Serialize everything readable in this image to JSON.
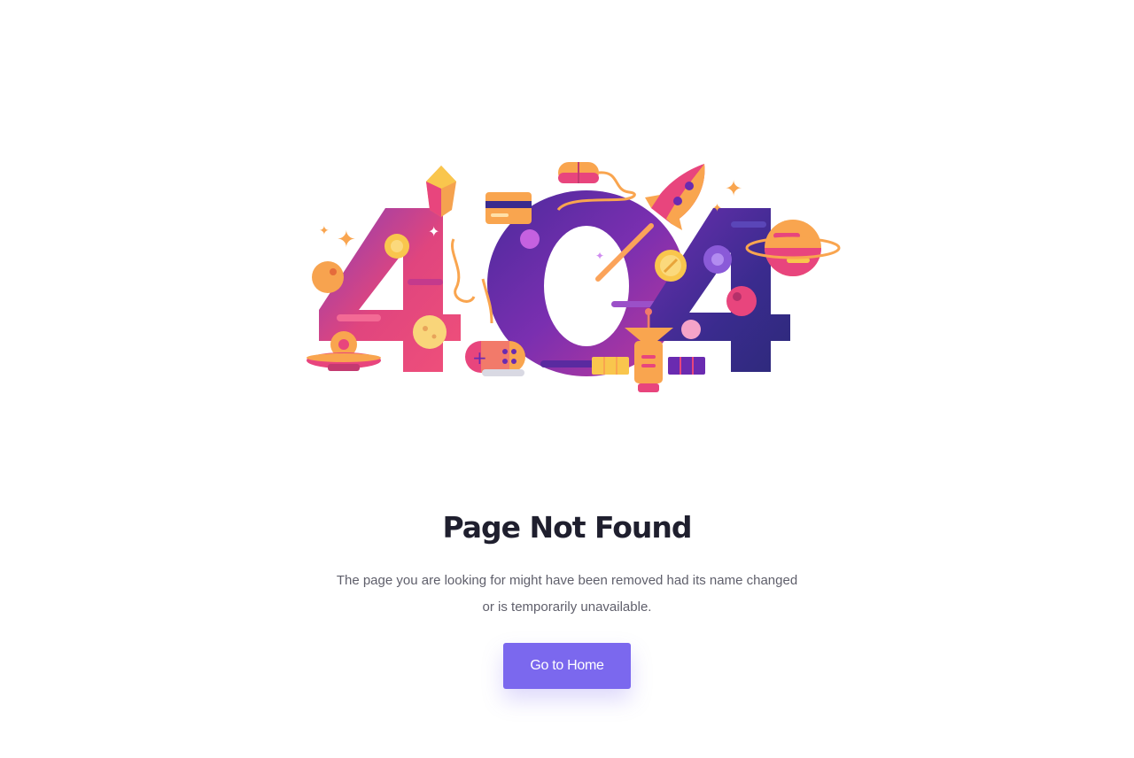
{
  "illustration": {
    "text": "404",
    "colors": {
      "pink": "#e8457d",
      "purple": "#6a2bb0",
      "deep_purple": "#3a2a8c",
      "orange": "#fba35a",
      "yellow": "#f9c64d"
    }
  },
  "heading": "Page Not Found",
  "description": {
    "line1": "The page you are looking for might have been removed had its name changed",
    "line2": "or is temporarily unavailable."
  },
  "button": {
    "label": "Go to Home",
    "color": "#7b68ee"
  }
}
